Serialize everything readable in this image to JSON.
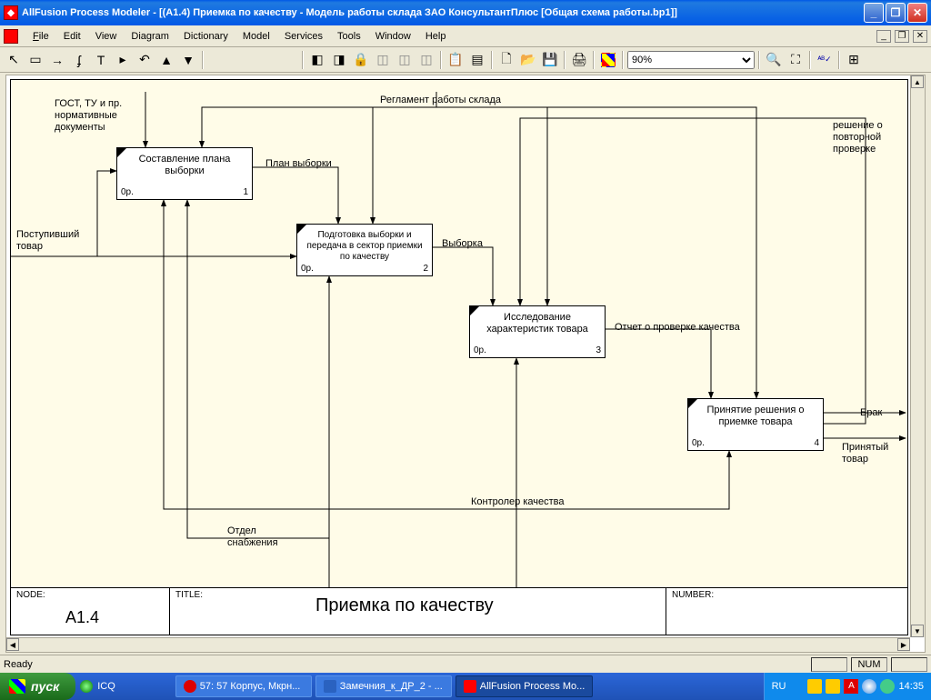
{
  "window": {
    "title": "AllFusion Process Modeler  - [(A1.4) Приемка  по качеству  - Модель работы склада ЗАО КонсультантПлюс  [Общая схема работы.bp1]]"
  },
  "menu": {
    "file": "File",
    "edit": "Edit",
    "view": "View",
    "diagram": "Diagram",
    "dictionary": "Dictionary",
    "model": "Model",
    "services": "Services",
    "tools": "Tools",
    "window": "Window",
    "help": "Help"
  },
  "toolbar": {
    "zoom": "90%"
  },
  "diagram": {
    "labels": {
      "gost": "ГОСТ, ТУ и пр. нормативные документы",
      "reglament": "Регламент работы склада",
      "reshenie": "решение о повторной проверке",
      "postupivshiy": "Поступивший товар",
      "plan_vyborki": "План выборки",
      "vyborka": "Выборка",
      "otchet": "Отчет о проверке качества",
      "brak": "Брак",
      "prinyatyi": "Принятый товар",
      "kontroler": "Контролер качества",
      "otdel": "Отдел снабжения"
    },
    "activities": {
      "a1": {
        "text": "Составление плана выборки",
        "op": "0р.",
        "num": "1"
      },
      "a2": {
        "text": "Подготовка выборки и передача в сектор приемки по качеству",
        "op": "0р.",
        "num": "2"
      },
      "a3": {
        "text": "Исследование характеристик товара",
        "op": "0р.",
        "num": "3"
      },
      "a4": {
        "text": "Принятие решения о приемке товара",
        "op": "0р.",
        "num": "4"
      }
    },
    "footer": {
      "node_label": "NODE:",
      "node_value": "A1.4",
      "title_label": "TITLE:",
      "title_value": "Приемка  по качеству",
      "number_label": "NUMBER:"
    }
  },
  "status": {
    "ready": "Ready",
    "num": "NUM"
  },
  "taskbar": {
    "start": "пуск",
    "ql_icq": "ICQ",
    "items": {
      "t1": "57: 57 Корпус, Мкрн...",
      "t2": "Замечния_к_ДР_2 - ...",
      "t3": "AllFusion Process Mo..."
    },
    "lang": "RU",
    "clock": "14:35"
  }
}
